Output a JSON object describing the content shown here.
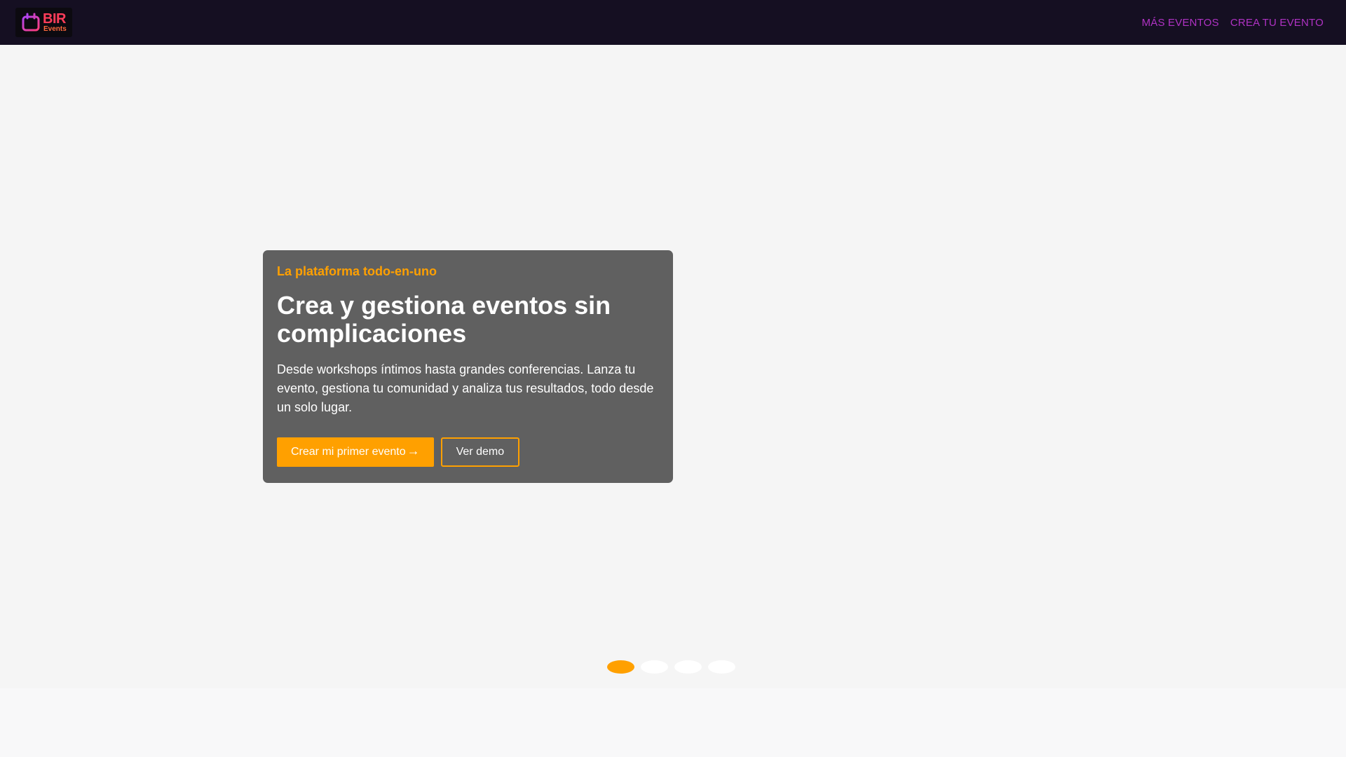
{
  "navbar": {
    "logo": {
      "main": "BIR",
      "sub": "Events"
    },
    "links": [
      "MÁS EVENTOS",
      "CREA TU EVENTO"
    ]
  },
  "hero": {
    "eyebrow": "La plataforma todo-en-uno",
    "title": "Crea y gestiona eventos sin complicaciones",
    "description": "Desde workshops íntimos hasta grandes conferencias. Lanza tu evento, gestiona tu comunidad y analiza tus resultados, todo desde un solo lugar.",
    "primary_cta": "Crear mi primer evento",
    "secondary_cta": "Ver demo"
  },
  "carousel": {
    "slide_count": 4,
    "active_index": 0
  },
  "colors": {
    "navbar_bg": "#150f22",
    "nav_link": "#b032c4",
    "accent": "#ffa000",
    "card_bg": "#606060",
    "hero_bg": "#f5f5f5"
  },
  "icons": {
    "logo": "calendar-icon",
    "primary_cta": "arrow-right-icon",
    "prev": "chevron-left-icon",
    "next": "chevron-right-icon"
  }
}
